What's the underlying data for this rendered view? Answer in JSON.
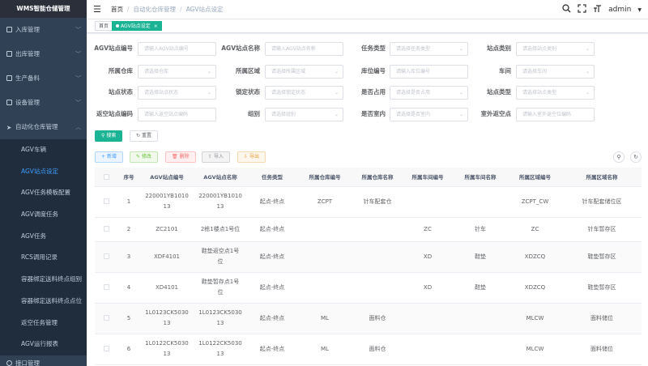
{
  "sidebar": {
    "logo": "WMS智能仓储管理",
    "menus": [
      {
        "label": "入库管理",
        "arrow": "﹀"
      },
      {
        "label": "出库管理",
        "arrow": "﹀"
      },
      {
        "label": "生产备料",
        "arrow": "﹀"
      },
      {
        "label": "设备管理",
        "arrow": "﹀"
      },
      {
        "label": "自动化仓库管理",
        "arrow": "︿"
      }
    ],
    "sub_items": [
      {
        "label": "AGV车辆"
      },
      {
        "label": "AGV站点设定"
      },
      {
        "label": "AGV任务模板配置"
      },
      {
        "label": "AGV调度任务"
      },
      {
        "label": "AGV任务"
      },
      {
        "label": "RCS调用记录"
      },
      {
        "label": "容器绑定送料终点组别"
      },
      {
        "label": "容器绑定送料终点点位"
      },
      {
        "label": "返空任务管理"
      },
      {
        "label": "AGV运行报表"
      }
    ],
    "last_menu": {
      "label": "接口管理"
    }
  },
  "navbar": {
    "breadcrumb": [
      "首页",
      "自动化仓库管理",
      "AGV站点设定"
    ],
    "separator": "/",
    "user": "admin"
  },
  "tags": [
    {
      "label": "首页"
    },
    {
      "label": "AGV站点设定",
      "close": "×"
    }
  ],
  "form": {
    "rows": [
      [
        {
          "label": "AGV站点编号",
          "placeholder": "请输入AGV站点编号",
          "type": "input"
        },
        {
          "label": "AGV站点名称",
          "placeholder": "请输入AGV站点名称",
          "type": "input"
        },
        {
          "label": "任务类型",
          "placeholder": "请选择任务类型",
          "type": "select"
        },
        {
          "label": "站点类别",
          "placeholder": "请选择站点类别",
          "type": "select"
        }
      ],
      [
        {
          "label": "所属仓库",
          "placeholder": "请选择仓库",
          "type": "select"
        },
        {
          "label": "所属区域",
          "placeholder": "请选择所属区域",
          "type": "select"
        },
        {
          "label": "库位编号",
          "placeholder": "请输入库位编号",
          "type": "input"
        },
        {
          "label": "车间",
          "placeholder": "请选择车间",
          "type": "select"
        }
      ],
      [
        {
          "label": "站点状态",
          "placeholder": "请选择站点状态",
          "type": "select"
        },
        {
          "label": "锁定状态",
          "placeholder": "请选择锁定状态",
          "type": "select"
        },
        {
          "label": "是否占用",
          "placeholder": "请选择是否占用",
          "type": "select"
        },
        {
          "label": "站点类型",
          "placeholder": "请选择站点类型",
          "type": "select"
        }
      ],
      [
        {
          "label": "返空站点编码",
          "placeholder": "请输入返空站点编码",
          "type": "input"
        },
        {
          "label": "组别",
          "placeholder": "请选择组别",
          "type": "select"
        },
        {
          "label": "是否室内",
          "placeholder": "请选择是否室内",
          "type": "select"
        },
        {
          "label": "室外返空点",
          "placeholder": "请输入室外返空位编码",
          "type": "input"
        }
      ]
    ],
    "search_label": "搜索",
    "reset_label": "重置"
  },
  "toolbar": {
    "add": "新增",
    "edit": "修改",
    "delete": "删除",
    "import": "导入",
    "export": "导出"
  },
  "table": {
    "headers": [
      "序号",
      "AGV站点编号",
      "AGV站点名称",
      "任务类型",
      "所属仓库编号",
      "所属仓库名称",
      "所属车间编号",
      "所属车间名称",
      "所属区域编号",
      "所属区域名称"
    ],
    "rows": [
      [
        "1",
        "220001YB1010\n13",
        "220001YB1010\n13",
        "起点-终点",
        "ZCPT",
        "针车配套仓",
        "",
        "",
        "ZCPT_CW",
        "针车配套储位区"
      ],
      [
        "2",
        "ZC2101",
        "2栋1楼点1号位",
        "起点-终点",
        "",
        "",
        "ZC",
        "针车",
        "ZC",
        "针车暂存区"
      ],
      [
        "3",
        "XDF4101",
        "鞋垫返空点1号\n位",
        "起点-终点",
        "",
        "",
        "XD",
        "鞋垫",
        "XDZCQ",
        "鞋垫暂存区"
      ],
      [
        "4",
        "XD4101",
        "鞋垫暂存点1号\n位",
        "起点-终点",
        "",
        "",
        "XD",
        "鞋垫",
        "XDZCQ",
        "鞋垫暂存区"
      ],
      [
        "5",
        "1L0123CK5030\n13",
        "1L0123CK5030\n13",
        "起点-终点",
        "ML",
        "面料仓",
        "",
        "",
        "MLCW",
        "面料储位"
      ],
      [
        "6",
        "1L0122CK5030\n13",
        "1L0122CK5030\n13",
        "起点-终点",
        "ML",
        "面料仓",
        "",
        "",
        "MLCW",
        "面料储位"
      ]
    ]
  }
}
